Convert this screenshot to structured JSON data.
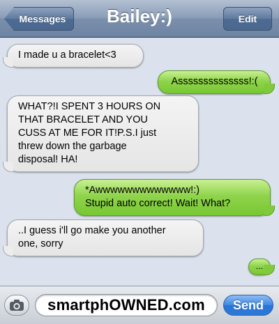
{
  "navbar": {
    "back_label": "Messages",
    "title": "Bailey:)",
    "edit_label": "Edit"
  },
  "messages": [
    {
      "sender": "contact",
      "text": "I made u a bracelet<3"
    },
    {
      "sender": "me",
      "text": "Assssssssssssss!:("
    },
    {
      "sender": "contact",
      "lines": [
        "WHAT?!I SPENT 3 HOURS ON",
        "THAT BRACELET AND YOU",
        "CUSS AT ME FOR IT!P.S.I just",
        "threw down the garbage",
        "disposal! HA!"
      ]
    },
    {
      "sender": "me",
      "lines": [
        "*Awwwwwwwwwwwww!:)",
        "Stupid auto correct! Wait! What?"
      ]
    },
    {
      "sender": "contact",
      "lines": [
        "..I guess i'll go make you another",
        "one, sorry"
      ]
    },
    {
      "sender": "me",
      "text": "..."
    }
  ],
  "input_bar": {
    "camera_icon": "camera-icon",
    "field_text": "smartphOWNED.com",
    "send_label": "Send"
  },
  "colors": {
    "incoming_bubble": "#e8e8e8",
    "outgoing_bubble": "#8fd44b",
    "background": "#dbe2ed",
    "send_button": "#3c87e5"
  }
}
